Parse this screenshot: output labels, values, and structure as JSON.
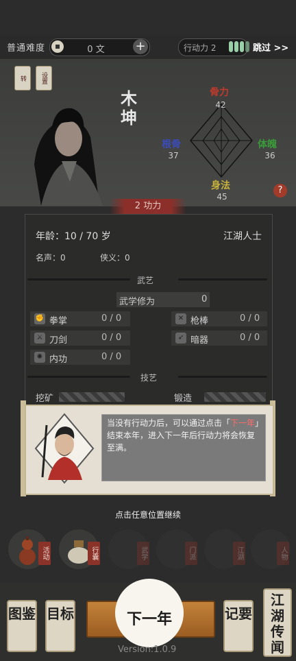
{
  "topbar": {
    "difficulty": "普通难度",
    "coins": "0 文",
    "add_icon": "plus-icon",
    "action_label": "行动力 2",
    "action_pips": 4,
    "skip": "跳过 >>"
  },
  "buttons": {
    "hat": "转",
    "settings": "设置",
    "help": "?"
  },
  "character": {
    "name": "木坤",
    "power": "2 功力",
    "stats": {
      "bone": {
        "label": "骨力",
        "value": "42"
      },
      "root": {
        "label": "根骨",
        "value": "37"
      },
      "physique": {
        "label": "体魄",
        "value": "36"
      },
      "agility": {
        "label": "身法",
        "value": "45"
      }
    },
    "age": "年龄：10 / 70 岁",
    "origin": "江湖人士",
    "fame": "名声：0",
    "chivalry": "侠义：0"
  },
  "martial": {
    "title": "武艺",
    "cultivation_label": "武学修为",
    "cultivation_value": "0",
    "rows": [
      {
        "label": "拳掌",
        "value": "0 / 0",
        "icon": "fist-icon"
      },
      {
        "label": "枪棒",
        "value": "0 / 0",
        "icon": "crossed-staff-icon"
      },
      {
        "label": "刀剑",
        "value": "0 / 0",
        "icon": "sword-icon"
      },
      {
        "label": "暗器",
        "value": "0 / 0",
        "icon": "dart-icon"
      },
      {
        "label": "内功",
        "value": "0 / 0",
        "icon": "energy-icon"
      }
    ]
  },
  "crafts": {
    "title": "技艺",
    "mining": "挖矿",
    "forging": "锻造"
  },
  "dialog": {
    "text_before": "当没有行动力后，可以通过点击「",
    "highlight": "下一年",
    "text_after": "」结束本年，进入下一年后行动力将会恢复至满。",
    "continue": "点击任意位置继续"
  },
  "functions": [
    {
      "badge": "活动",
      "icon": "gourd-icon",
      "faded": false
    },
    {
      "badge": "行囊",
      "icon": "bag-icon",
      "faded": false
    },
    {
      "badge": "武学",
      "icon": "book-icon",
      "faded": true
    },
    {
      "badge": "门派",
      "icon": "temple-icon",
      "faded": true
    },
    {
      "badge": "江湖",
      "icon": "town-icon",
      "faded": true
    },
    {
      "badge": "人物",
      "icon": "people-icon",
      "faded": true
    }
  ],
  "nav": {
    "atlas": "图鉴",
    "goal": "目标",
    "next_year": "下一年",
    "notes": "记要",
    "legend": "江湖传闻",
    "version": "Version:1.0.9"
  },
  "colors": {
    "accent_red": "#8c2f2a",
    "bone_color": "#c0392b",
    "root_color": "#3b4bb8",
    "physique_color": "#3a9b3a",
    "agility_color": "#b8a23a"
  }
}
